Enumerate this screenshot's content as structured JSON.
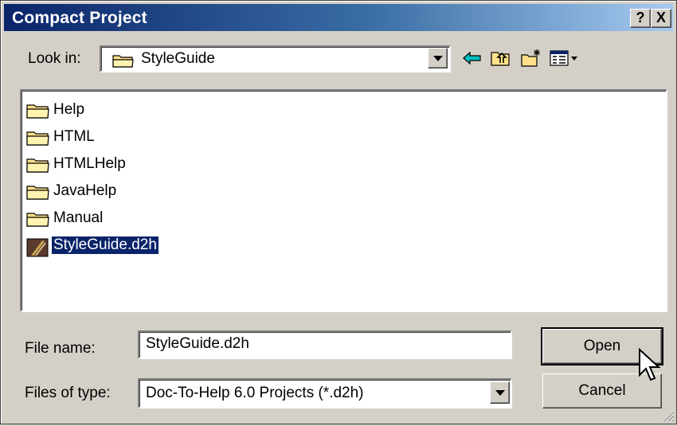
{
  "window": {
    "title": "Compact Project",
    "help_glyph": "?",
    "close_glyph": "X"
  },
  "look_in": {
    "label": "Look in:",
    "value": "StyleGuide",
    "icon": "folder-icon"
  },
  "toolbar": {
    "icons": [
      "back-arrow-icon",
      "up-one-level-icon",
      "new-folder-icon",
      "view-menu-icon"
    ]
  },
  "files": [
    {
      "name": "Help",
      "type": "folder"
    },
    {
      "name": "HTML",
      "type": "folder"
    },
    {
      "name": "HTMLHelp",
      "type": "folder"
    },
    {
      "name": "JavaHelp",
      "type": "folder"
    },
    {
      "name": "Manual",
      "type": "folder"
    },
    {
      "name": "StyleGuide.d2h",
      "type": "project",
      "selected": true
    }
  ],
  "file_name": {
    "label": "File name:",
    "value": "StyleGuide.d2h"
  },
  "file_type": {
    "label": "Files of type:",
    "value": "Doc-To-Help 6.0 Projects (*.d2h)"
  },
  "buttons": {
    "open": "Open",
    "cancel": "Cancel"
  },
  "colors": {
    "selection": "#0a246a",
    "title_start": "#0a246a",
    "title_end": "#a6caf0",
    "face": "#d4d0c8",
    "folder": "#ffe18a"
  }
}
